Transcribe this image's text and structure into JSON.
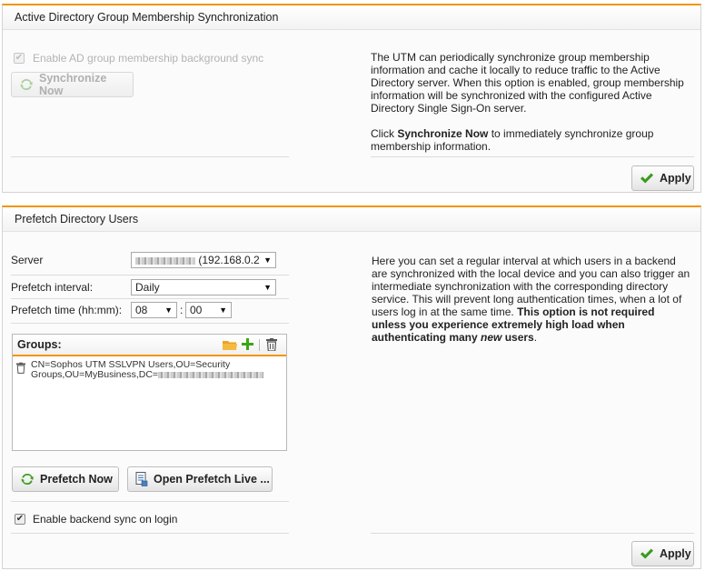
{
  "ad_sync": {
    "title": "Active Directory Group Membership Synchronization",
    "enable_label": "Enable AD group membership background sync",
    "enable_checked": true,
    "sync_now_label": "Synchronize Now",
    "desc_text": "The UTM can periodically synchronize group membership information and cache it locally to reduce traffic to the Active Directory server. When this option is enabled, group membership information will be synchronized with the configured Active Directory Single Sign-On server.",
    "click_prefix": "Click ",
    "click_bold": "Synchronize Now",
    "click_suffix": " to immediately synchronize group membership information.",
    "apply_label": "Apply"
  },
  "prefetch": {
    "title": "Prefetch Directory Users",
    "server_label": "Server",
    "server_value": "(192.168.0.2",
    "interval_label": "Prefetch interval:",
    "interval_value": "Daily",
    "time_label": "Prefetch time (hh:mm):",
    "hour_value": "08",
    "time_colon": ":",
    "minute_value": "00",
    "groups_label": "Groups:",
    "group_entry_1": "CN=Sophos UTM SSLVPN Users,OU=Security",
    "group_entry_2": "Groups,OU=MyBusiness,DC=",
    "prefetch_now_label": "Prefetch Now",
    "open_live_label": "Open Prefetch Live ...",
    "backend_sync_label": "Enable backend sync on login",
    "backend_sync_checked": true,
    "desc_text": "Here you can set a regular interval at which users in a backend are synchronized with the local device and you can also trigger an intermediate synchronization with the corresponding directory service. This will prevent long authentication times, when a lot of users log in at the same time. ",
    "desc_bold1": "This option is not required unless you experience extremely high load when authenticating many ",
    "desc_bold_italic": "new",
    "desc_bold2": " users",
    "desc_end": ".",
    "apply_label": "Apply"
  },
  "colors": {
    "accent": "#f29400",
    "check_green": "#3a9a1e",
    "plus_green": "#3aa616"
  },
  "icons": [
    "refresh-icon",
    "checkmark-icon",
    "folder-icon",
    "plus-icon",
    "trash-icon",
    "document-icon"
  ]
}
